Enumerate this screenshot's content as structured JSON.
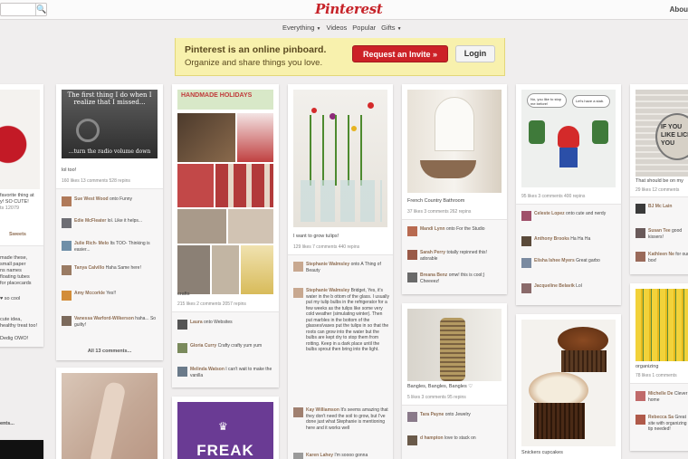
{
  "topbar": {
    "logo": "Pinterest",
    "about": "Abou",
    "search_button": "🔍"
  },
  "subnav": {
    "everything": "Everything",
    "videos": "Videos",
    "popular": "Popular",
    "gifts": "Gifts"
  },
  "banner": {
    "line1": "Pinterest is an online pinboard.",
    "line2": "Organize and share things you love.",
    "invite_label": "Request an Invite »",
    "login_label": "Login"
  },
  "col0": {
    "lines": [
      "favorite thing at",
      "y! SO CUTE!",
      "ts   12079"
    ],
    "sweets": "Sweets",
    "c1": [
      "made these,",
      "small paper",
      "ns names",
      "floating tubes",
      "for placecards"
    ],
    "so_cool": "so cool",
    "c3": [
      "cute idea,",
      "healthy treat too!"
    ],
    "owo": "Dedig OWO!",
    "ents": "ents..."
  },
  "col1": {
    "meme_top": "The first thing I do when I realize that I missed...",
    "meme_bottom": "...turn the radio volume down",
    "caption": "lol too!",
    "stats": "160 likes   13 comments   528 repins",
    "comments": [
      {
        "name": "Sue West Wood",
        "text": "onto Funny"
      },
      {
        "name": "Edie McFleater",
        "text": "lol. Like it helps..."
      },
      {
        "name": "Julie Rich- Melo",
        "text": "Its TOO- Thinking is easier..."
      },
      {
        "name": "Tanya Calvillo",
        "text": "Haha Same here!"
      },
      {
        "name": "Amy Mccorkle",
        "text": "Yes!!"
      },
      {
        "name": "Vanessa Warford-Wilkerson",
        "text": "haha... So guilty!"
      }
    ],
    "more": "All 13 comments..."
  },
  "col2": {
    "handmade": "HANDMADE HOLIDAYS",
    "caption": "crafts",
    "stats": "215 likes   2 comments   2057 repins",
    "comments": [
      {
        "name": "Laura",
        "text": "onto Websites"
      },
      {
        "name": "Gloria Curry",
        "text": "Crafty crafty yum yum"
      },
      {
        "name": "Melinda Watson",
        "text": "I can't wait to make the vanilla"
      }
    ],
    "freak": "FREAK"
  },
  "col3": {
    "caption": "I want to grow tulips!",
    "stats": "129 likes   7 comments   440 repins",
    "comments": [
      {
        "name": "Stephanie Walmsley",
        "text": "onto A Thing of Beauty"
      },
      {
        "name": "Stephanie Walmsley",
        "text": "Bridget, Yes, it's water in the b ottom of the glass. I usually put my tulip bulbs in the refrigerator for a few weeks as the tulips like some very cold weather (simulating winter). Then put marbles in the bottom of the glasses/vases put the tulips in so that the roots can grow into the water but the bulbs are kept dry to stop them from rotting. Keep in a dark place until the bulbs sprout then bring into the light."
      },
      {
        "name": "Kay Williamson",
        "text": "It's seems amazing that they don't need the soil to grow, but I've done just what Stephanie is mentioning here and it works well"
      },
      {
        "name": "Karen Lahey",
        "text": "I'm soooo gonna"
      }
    ]
  },
  "col4": {
    "caption": "French Country Bathroom",
    "stats": "37 likes   3 comments   262 repins",
    "comments": [
      {
        "name": "Mandi Lynn",
        "text": "onto For the Studio"
      },
      {
        "name": "Sarah Perry",
        "text": "totally repinned this! adorable"
      },
      {
        "name": "Breana Benz",
        "text": "omw! this is cool;) Cheeeez!"
      }
    ],
    "caption2": "Bangles, Bangles, Bangles ♡",
    "stats2": "5 likes   3 comments   95 repins",
    "comments2": [
      {
        "name": "Tara Payne",
        "text": "onto Jewelry"
      },
      {
        "name": "d hampton",
        "text": "love to stack on"
      }
    ]
  },
  "col5": {
    "bubble1": "No, you like to stop me before!",
    "bubble2": "Let's have a stab.",
    "stats": "95 likes   3 comments   400 repins",
    "comments": [
      {
        "name": "Celeste Lopez",
        "text": "onto cute and nerdy"
      },
      {
        "name": "Anthony Brooks",
        "text": "Ha Ha Ha"
      },
      {
        "name": "Elisha Ishee Myers",
        "text": "Great garbo"
      },
      {
        "name": "Jacqueline Belavik",
        "text": "Lol"
      }
    ],
    "caption2": "Snickers cupcakes"
  },
  "col6": {
    "note_text": "IF YOU LIKE LICK YOU",
    "caption": "That should be on my",
    "stats": "29 likes   12 comments",
    "comments": [
      {
        "name": "BJ Mc Lain",
        "text": ""
      },
      {
        "name": "Susan Tee",
        "text": "good kissers!"
      },
      {
        "name": "Kathleen Ne",
        "text": "for our box!"
      }
    ],
    "caption2": "organizing",
    "stats2": "78 likes   1 comments",
    "comments2": [
      {
        "name": "Michelle De",
        "text": "Clever home"
      },
      {
        "name": "Rebecca Sa",
        "text": "Great site with organizing tip needed!"
      }
    ]
  }
}
